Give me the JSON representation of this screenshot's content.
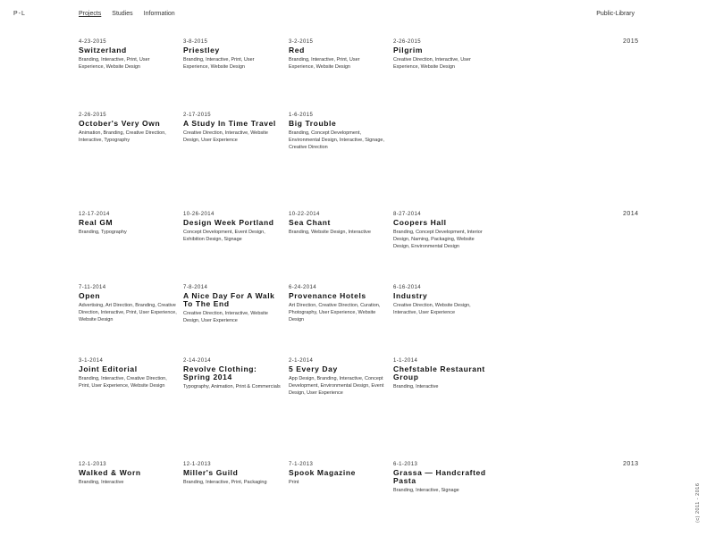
{
  "header": {
    "logo": "P-L",
    "nav": [
      {
        "label": "Projects",
        "active": true
      },
      {
        "label": "Studies",
        "active": false
      },
      {
        "label": "Information",
        "active": false
      }
    ],
    "public_library": "Public-Library"
  },
  "years": [
    "2015",
    "2014",
    "2013"
  ],
  "projects": [
    {
      "date": "4-23-2015",
      "title": "Switzerland",
      "tags": "Branding, Interactive, Print, User Experience, Website Design"
    },
    {
      "date": "3-8-2015",
      "title": "Priestley",
      "tags": "Branding, Interactive, Print, User Experience, Website Design"
    },
    {
      "date": "3-2-2015",
      "title": "Red",
      "tags": "Branding, Interactive, Print, User Experience, Website Design"
    },
    {
      "date": "2-26-2015",
      "title": "Pilgrim",
      "tags": "Creative Direction, Interactive, User Experience, Website Design"
    },
    {
      "date": "2-26-2015",
      "title": "October's Very Own",
      "tags": "Animation, Branding, Creative Direction, Interactive, Typography"
    },
    {
      "date": "2-17-2015",
      "title": "A Study In Time Travel",
      "tags": "Creative Direction, Interactive, Website Design, User Experience"
    },
    {
      "date": "1-6-2015",
      "title": "Big Trouble",
      "tags": "Branding, Concept Development, Environmental Design, Interactive, Signage, Creative Direction"
    },
    {
      "date": "12-17-2014",
      "title": "Real GM",
      "tags": "Branding, Typography"
    },
    {
      "date": "10-26-2014",
      "title": "Design Week Portland",
      "tags": "Concept Development, Event Design, Exhibition Design, Signage"
    },
    {
      "date": "10-22-2014",
      "title": "Sea Chant",
      "tags": "Branding, Website Design, Interactive"
    },
    {
      "date": "8-27-2014",
      "title": "Coopers Hall",
      "tags": "Branding, Concept Development, Interior Design, Naming, Packaging, Website Design, Environmental Design"
    },
    {
      "date": "7-11-2014",
      "title": "Open",
      "tags": "Advertising, Art Direction, Branding, Creative Direction, Interactive, Print, User Experience, Website Design"
    },
    {
      "date": "7-8-2014",
      "title": "A Nice Day For A Walk To The End",
      "tags": "Creative Direction, Interactive, Website Design, User Experience"
    },
    {
      "date": "6-24-2014",
      "title": "Provenance Hotels",
      "tags": "Art Direction, Creative Direction, Curation, Photography, User Experience, Website Design"
    },
    {
      "date": "6-16-2014",
      "title": "Industry",
      "tags": "Creative Direction, Website Design, Interactive, User Experience"
    },
    {
      "date": "3-1-2014",
      "title": "Joint Editorial",
      "tags": "Branding, Interactive, Creative Direction, Print, User Experience, Website Design"
    },
    {
      "date": "2-14-2014",
      "title": "Revolve Clothing: Spring 2014",
      "tags": "Typography, Animation, Print & Commercials"
    },
    {
      "date": "2-1-2014",
      "title": "5 Every Day",
      "tags": "App Design, Branding, Interactive, Concept Development, Environmental Design, Event Design, User Experience"
    },
    {
      "date": "1-1-2014",
      "title": "Chefstable Restaurant Group",
      "tags": "Branding, Interactive"
    },
    {
      "date": "12-1-2013",
      "title": "Walked & Worn",
      "tags": "Branding, Interactive"
    },
    {
      "date": "12-1-2013",
      "title": "Miller's Guild",
      "tags": "Branding, Interactive, Print, Packaging"
    },
    {
      "date": "7-1-2013",
      "title": "Spook Magazine",
      "tags": "Print"
    },
    {
      "date": "6-1-2013",
      "title": "Grassa — Handcrafted Pasta",
      "tags": "Branding, Interactive, Signage"
    }
  ],
  "vertical_note": "(c) 2011 - 2016"
}
